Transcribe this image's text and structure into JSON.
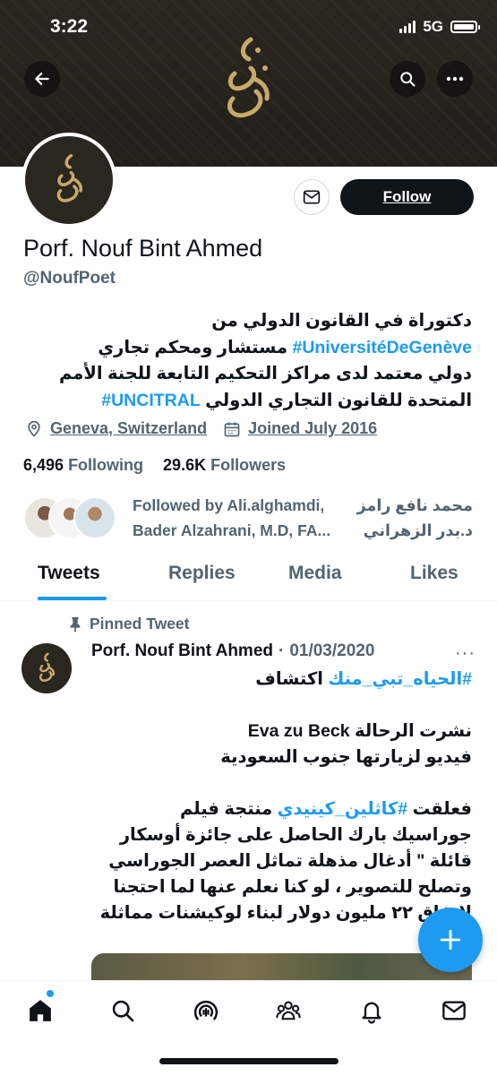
{
  "status_bar": {
    "time": "3:22",
    "network": "5G"
  },
  "profile": {
    "name": "Porf. Nouf Bint Ahmed",
    "handle": "@NoufPoet",
    "bio": {
      "line1": "دكتوراة في القانون الدولي من",
      "line2_hashtag": "#UniversitéDeGenève",
      "line2_text": " مستشار ومحكم تجاري",
      "line3": "دولي معتمد لدى مراكز التحكيم التابعة للجنة الأمم",
      "line4_text": "المتحدة للقانون التجاري الدولي ",
      "line4_hashtag": "#UNCITRAL"
    },
    "location": "Geneva, Switzerland",
    "joined": "Joined July 2016",
    "following_count": "6,496",
    "following_label": "Following",
    "followers_count": "29.6K",
    "followers_label": "Followers",
    "followed_by": {
      "r1_left": "Followed by Ali.alghamdi,",
      "r1_right": "محمد نافع رامز",
      "r2_left": "Bader Alzahrani, M.D, FA...",
      "r2_right": "د.بدر الزهراني"
    },
    "follow_label": "Follow"
  },
  "tabs": [
    {
      "label": "Tweets",
      "active": true
    },
    {
      "label": "Replies",
      "active": false
    },
    {
      "label": "Media",
      "active": false
    },
    {
      "label": "Likes",
      "active": false
    }
  ],
  "pinned_tweet": {
    "pinned_label": "Pinned Tweet",
    "author": "Porf. Nouf Bint Ahmed",
    "separator": "·",
    "date": "01/03/2020",
    "more": "···",
    "l1_hashtag": "#الحياه_تبي_منك",
    "l1_text": " اكتشاف",
    "l2": "نشرت الرحالة Eva zu Beck",
    "l3": "فيديو لزيارتها جنوب السعودية",
    "l4_pre": "فعلقت ",
    "l4_hashtag": "#كاثلين_كينيدي",
    "l4_post": " منتجة فيلم",
    "l5": "جوراسيك بارك الحاصل على جائزة أوسكار",
    "l6": "قائلة \" أدغال مذهلة تماثل العصر الجوراسي",
    "l7": "وتصلح للتصوير ، لو كنا نعلم عنها لما احتجنا",
    "l8": "لإنفاق ٢٢ مليون دولار لبناء لوكيشنات مماثلة"
  },
  "colors": {
    "accent": "#1d9bf0",
    "text": "#0f1419",
    "muted": "#536471",
    "banner": "#2a2620",
    "logo_gold": "#c9a968"
  },
  "icons": [
    "back-arrow-icon",
    "search-icon",
    "more-icon",
    "mail-icon",
    "location-icon",
    "calendar-icon",
    "pin-icon",
    "plus-icon",
    "home-icon",
    "explore-icon",
    "spaces-icon",
    "communities-icon",
    "bell-icon",
    "messages-icon"
  ]
}
